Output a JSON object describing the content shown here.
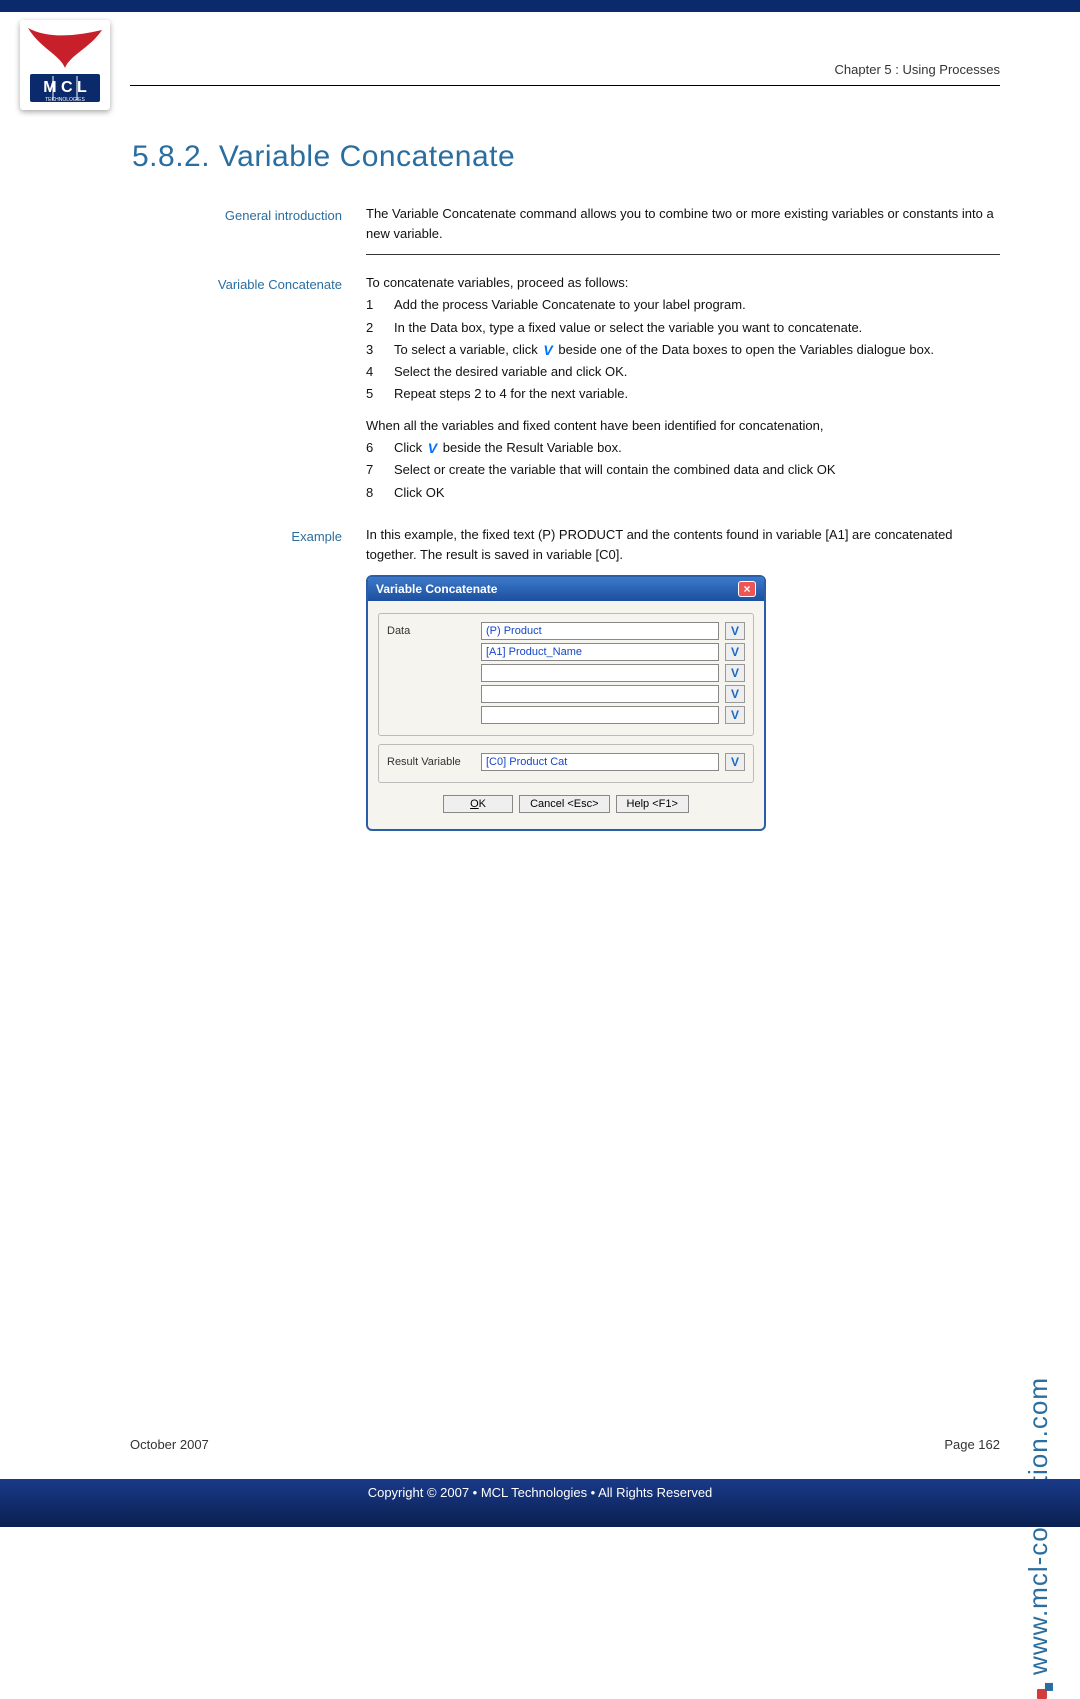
{
  "chapter": "Chapter 5 : Using Processes",
  "page_title": "5.8.2.    Variable Concatenate",
  "sections": {
    "intro_label": "General introduction",
    "intro_text": "The Variable Concatenate command allows you to combine two or more existing variables or constants into a new variable.",
    "proc_label": "Variable Concatenate",
    "proc_lead": "To concatenate variables, proceed as follows:",
    "steps1": {
      "s1": "Add the process Variable Concatenate to your label program.",
      "s2": "In the Data box, type a fixed value or select the variable you want to concatenate.",
      "s3a": "To select a variable, click ",
      "s3b": " beside one of the Data boxes to open the Variables dialogue box.",
      "s4": "Select the desired variable and click OK.",
      "s5": "Repeat steps 2 to 4 for the next variable."
    },
    "mid_text": "When all the variables and fixed content have been identified for concatenation,",
    "steps2": {
      "s6a": "Click ",
      "s6b": " beside the Result Variable box.",
      "s7": "Select or create the variable that will contain the combined data and click OK",
      "s8": "Click OK"
    },
    "example_label": "Example",
    "example_text": "In this example, the fixed text (P) PRODUCT and the contents found in variable [A1] are concatenated together. The result is saved in variable [C0]."
  },
  "dialog": {
    "title": "Variable Concatenate",
    "data_label": "Data",
    "data_rows": [
      "(P) Product",
      "[A1] Product_Name",
      "",
      "",
      ""
    ],
    "result_label": "Result Variable",
    "result_value": "[C0] Product Cat",
    "ok": "OK",
    "cancel": "Cancel <Esc>",
    "help": "Help <F1>"
  },
  "side_url": "www.mcl-collection.com",
  "footer_date": "October 2007",
  "footer_page": "Page 162",
  "footer_copy": "Copyright © 2007 • MCL Technologies • All Rights Reserved"
}
